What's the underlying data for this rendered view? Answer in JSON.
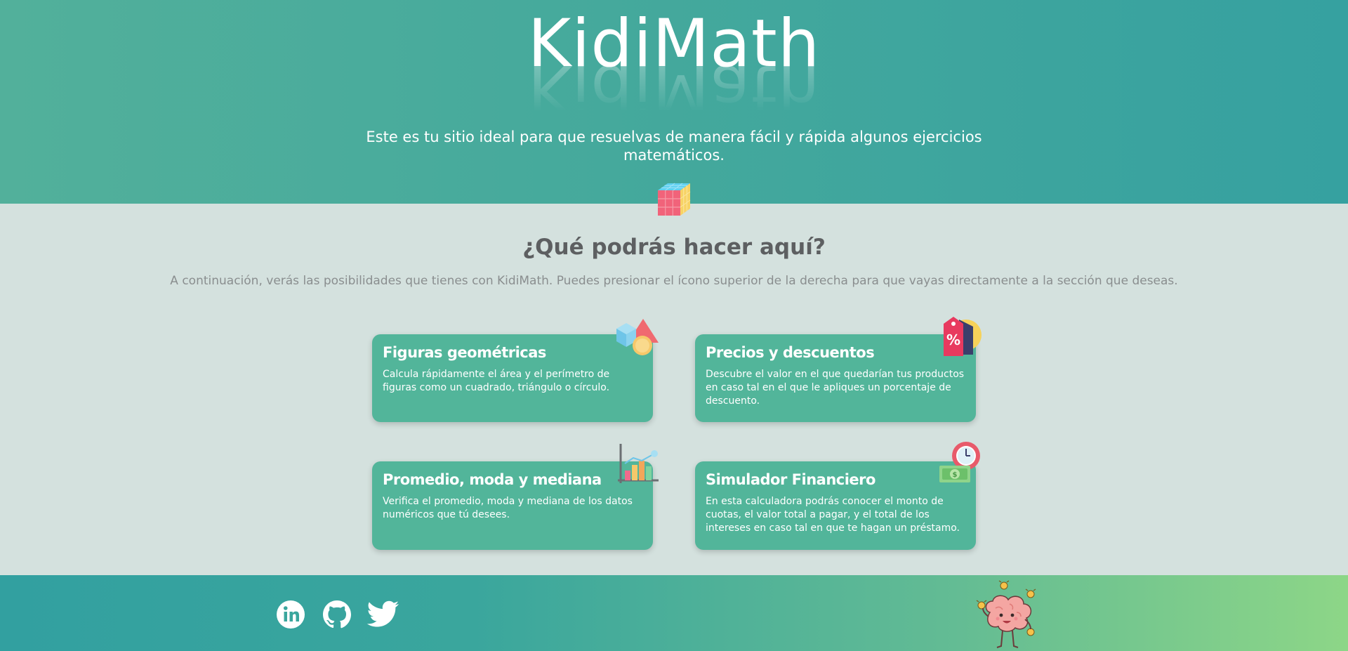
{
  "header": {
    "logo": "KidiMath",
    "subtitle": "Este es tu sitio ideal para que resuelvas de manera fácil y rápida algunos ejercicios matemáticos."
  },
  "main": {
    "title": "¿Qué podrás hacer aquí?",
    "description": "A continuación, verás las posibilidades que tienes con KidiMath. Puedes presionar el ícono superior de la derecha para que vayas directamente a la sección que deseas.",
    "cards": [
      {
        "title": "Figuras geométricas",
        "description": "Calcula rápidamente el área y el perímetro de figuras como un cuadrado, triángulo o círculo.",
        "icon": "shapes-icon"
      },
      {
        "title": "Precios y descuentos",
        "description": "Descubre el valor en el que quedarían tus productos en caso tal en el que le apliques un porcentaje de descuento.",
        "icon": "discount-tag-icon"
      },
      {
        "title": "Promedio, moda y mediana",
        "description": "Verifica el promedio, moda y mediana de los datos numéricos que tú desees.",
        "icon": "bar-chart-icon"
      },
      {
        "title": "Simulador Financiero",
        "description": "En esta calculadora podrás conocer el monto de cuotas, el valor total a pagar, y el total de los intereses en caso tal en que te hagan un préstamo.",
        "icon": "money-clock-icon"
      }
    ]
  },
  "footer": {
    "social": [
      "linkedin-icon",
      "github-icon",
      "twitter-icon"
    ],
    "mascot": "brain-mascot-icon"
  },
  "colors": {
    "hero": "#45a99c",
    "card": "#52b59a",
    "background": "#d4e1de",
    "footer_start": "#32a0a0",
    "footer_end": "#8dd687"
  }
}
